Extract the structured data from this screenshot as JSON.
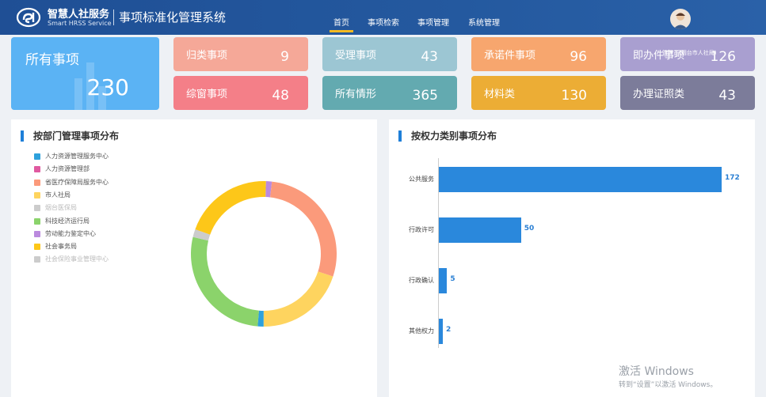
{
  "header": {
    "brand_cn": "智慧人社服务",
    "brand_en": "Smart HRSS Service",
    "system_title": "事项标准化管理系统",
    "nav": [
      {
        "label": "首页",
        "active": true
      },
      {
        "label": "事项检索",
        "active": false
      },
      {
        "label": "事项管理",
        "active": false
      },
      {
        "label": "系统管理",
        "active": false
      }
    ],
    "user_tip": "管理员(烟台市人社局)"
  },
  "tiles": {
    "total": {
      "label": "所有事项",
      "value": "230",
      "color": "#5bb3f4"
    },
    "items": [
      {
        "label": "归类事项",
        "value": "9",
        "color": "#f5a898"
      },
      {
        "label": "受理事项",
        "value": "43",
        "color": "#9cc6d3"
      },
      {
        "label": "承诺件事项",
        "value": "96",
        "color": "#f7a66e"
      },
      {
        "label": "即办件事项",
        "value": "126",
        "color": "#a99fd0"
      },
      {
        "label": "综窗事项",
        "value": "48",
        "color": "#f47f88"
      },
      {
        "label": "所有情形",
        "value": "365",
        "color": "#63aab0"
      },
      {
        "label": "材料类",
        "value": "130",
        "color": "#ecad35"
      },
      {
        "label": "办理证照类",
        "value": "43",
        "color": "#7c7c9a"
      }
    ]
  },
  "dept_panel": {
    "title": "按部门管理事项分布",
    "legend": [
      {
        "label": "人力资源管理服务中心",
        "color": "#2ea1dc",
        "value": 3
      },
      {
        "label": "人力资源管理部",
        "color": "#e05aa0",
        "value": 0
      },
      {
        "label": "省医疗保障局服务中心",
        "color": "#fb9a7b",
        "value": 65
      },
      {
        "label": "市人社局",
        "color": "#fed45f",
        "value": 46
      },
      {
        "label": "烟台医保局",
        "color": "#cccccc",
        "value": 0
      },
      {
        "label": "科技经济运行局",
        "color": "#8bd36b",
        "value": 63
      },
      {
        "label": "劳动能力鉴定中心",
        "color": "#bb8ade",
        "value": 3
      },
      {
        "label": "社会事务局",
        "color": "#fdc719",
        "value": 46
      },
      {
        "label": "社会保险事业管理中心",
        "color": "#cccccc",
        "value": 4
      }
    ]
  },
  "chart_data": {
    "type": "bar",
    "orientation": "horizontal",
    "title": "按权力类别事项分布",
    "categories": [
      "公共服务",
      "行政许可",
      "行政确认",
      "其他权力"
    ],
    "values": [
      172,
      50,
      5,
      2
    ],
    "xlim": [
      0,
      172
    ],
    "color": "#2a88dc"
  },
  "watermark": {
    "line1": "激活 Windows",
    "line2": "转到“设置”以激活 Windows。"
  }
}
